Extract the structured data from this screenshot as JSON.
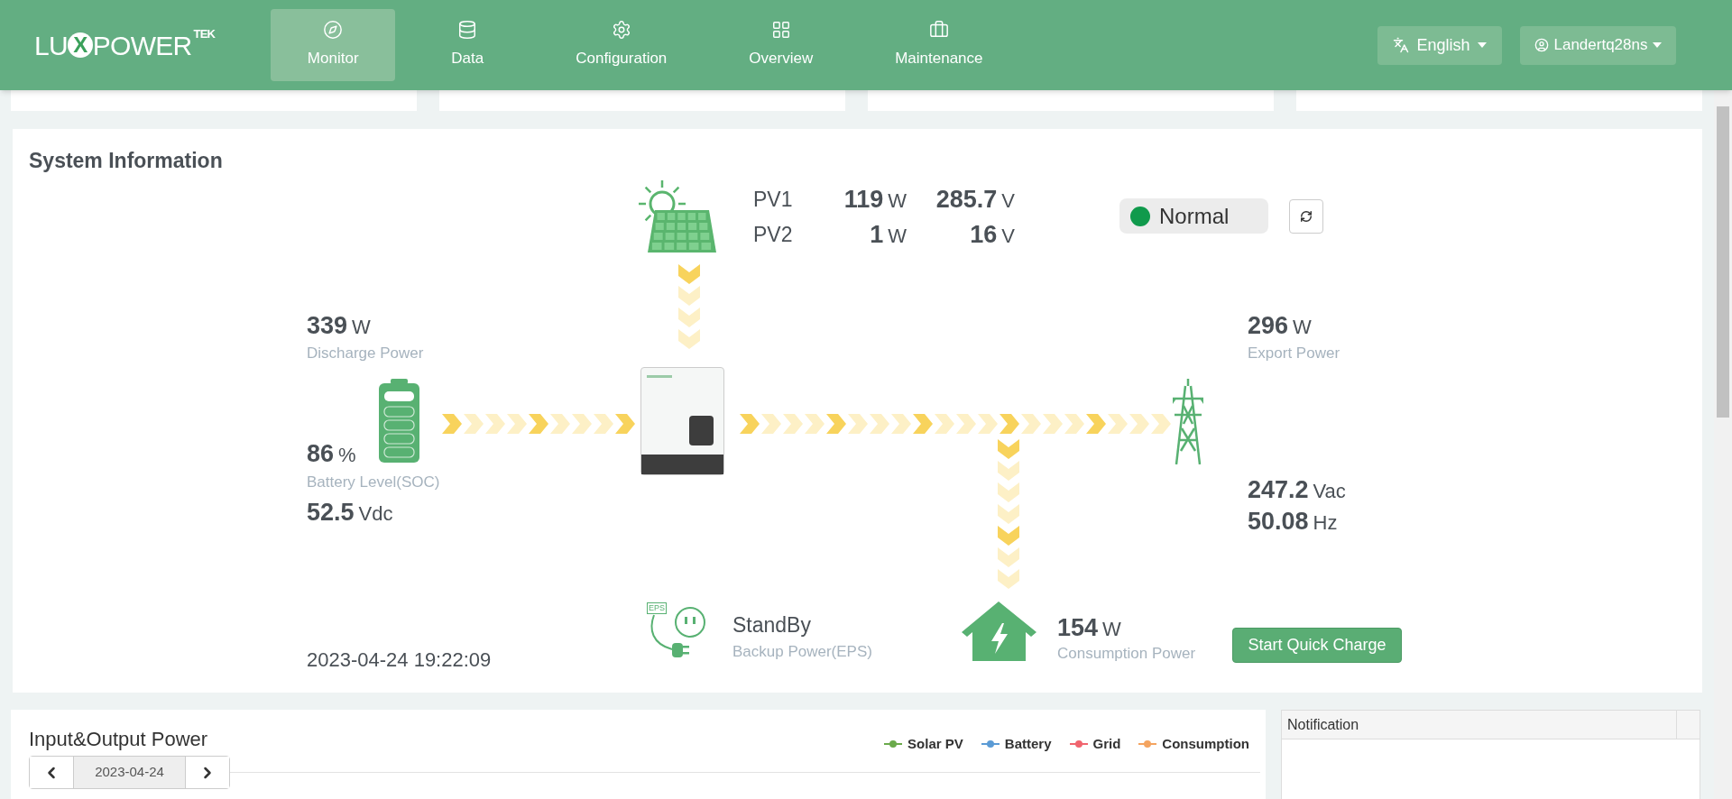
{
  "header": {
    "logo": {
      "before": "LU",
      "mark": "X",
      "after": "POWER",
      "superscript": "TEK"
    },
    "nav": [
      {
        "label": "Monitor",
        "selected": true
      },
      {
        "label": "Data",
        "selected": false
      },
      {
        "label": "Configuration",
        "selected": false
      },
      {
        "label": "Overview",
        "selected": false
      },
      {
        "label": "Maintenance",
        "selected": false
      }
    ],
    "language": {
      "label": "English"
    },
    "user": {
      "label": "Landertq28ns"
    }
  },
  "system_information": {
    "title": "System Information",
    "pv": [
      {
        "name": "PV1",
        "power": "119",
        "power_unit": "W",
        "voltage": "285.7",
        "voltage_unit": "V"
      },
      {
        "name": "PV2",
        "power": "1",
        "power_unit": "W",
        "voltage": "16",
        "voltage_unit": "V"
      }
    ],
    "status": {
      "label": "Normal"
    },
    "battery": {
      "power": "339",
      "power_unit": "W",
      "power_label": "Discharge Power",
      "soc": "86",
      "soc_unit": "%",
      "soc_label": "Battery Level(SOC)",
      "voltage": "52.5",
      "voltage_unit": "Vdc"
    },
    "grid": {
      "power": "296",
      "power_unit": "W",
      "power_label": "Export Power",
      "voltage": "247.2",
      "voltage_unit": "Vac",
      "frequency": "50.08",
      "frequency_unit": "Hz"
    },
    "timestamp": "2023-04-24 19:22:09",
    "eps": {
      "tag": "EPS",
      "status": "StandBy",
      "label": "Backup Power(EPS)"
    },
    "consumption": {
      "power": "154",
      "power_unit": "W",
      "label": "Consumption Power"
    },
    "quick_charge_button": "Start Quick Charge"
  },
  "input_output_power": {
    "title": "Input&Output Power",
    "date": "2023-04-24",
    "legend": [
      {
        "label": "Solar PV",
        "color": "#6aaa4b"
      },
      {
        "label": "Battery",
        "color": "#5b9bd5"
      },
      {
        "label": "Grid",
        "color": "#f0646e"
      },
      {
        "label": "Consumption",
        "color": "#f4a460"
      }
    ]
  },
  "notification": {
    "title": "Notification"
  }
}
